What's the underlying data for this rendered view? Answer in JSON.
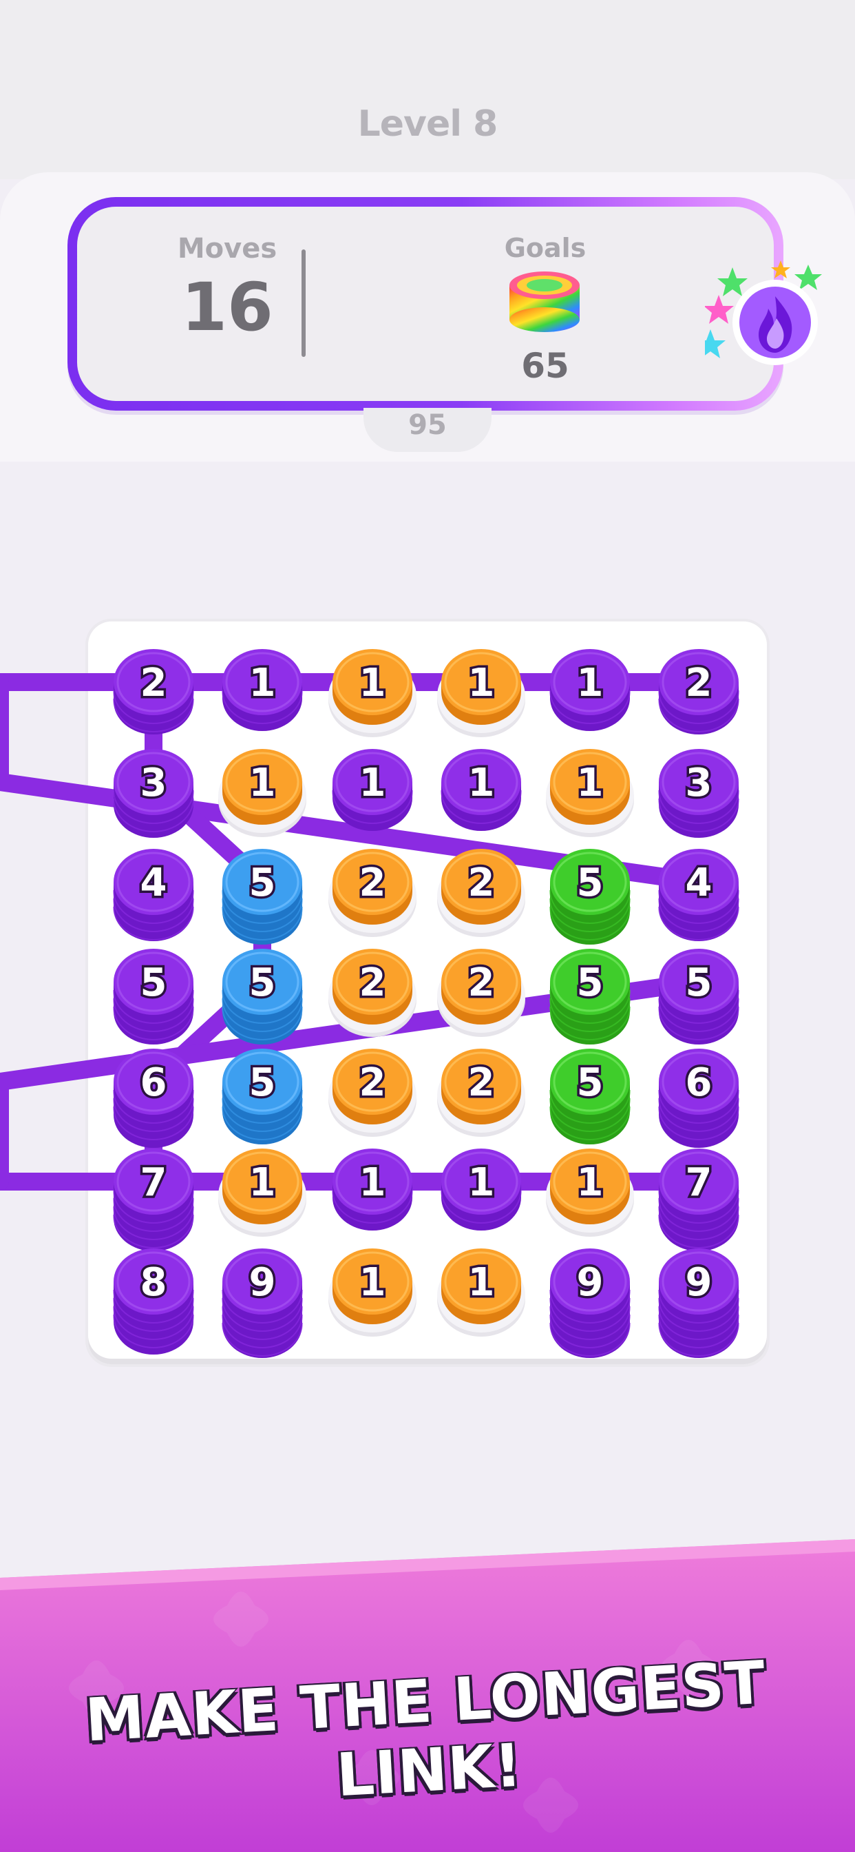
{
  "level_title": "Level 8",
  "hud": {
    "moves_label": "Moves",
    "moves_value": "16",
    "goals_label": "Goals",
    "goal_icon": "rainbow-chip-stack-icon",
    "goals_value": "65",
    "score_value": "95",
    "booster_icon": "purple-flame-icon"
  },
  "colors": {
    "purple": "#8b2be2",
    "orange": "#fba12a",
    "blue": "#3a9ce8",
    "green": "#3fcb2a",
    "accent": "#8a3df5",
    "banner_pink": "#f27ad6",
    "banner_magenta": "#c23fd8"
  },
  "board": {
    "rows": [
      [
        {
          "c": "purple",
          "n": "2",
          "h": 2
        },
        {
          "c": "purple",
          "n": "1",
          "h": 1
        },
        {
          "c": "orange",
          "n": "1",
          "h": 0
        },
        {
          "c": "orange",
          "n": "1",
          "h": 0
        },
        {
          "c": "purple",
          "n": "1",
          "h": 1
        },
        {
          "c": "purple",
          "n": "2",
          "h": 2
        }
      ],
      [
        {
          "c": "purple",
          "n": "3",
          "h": 3
        },
        {
          "c": "orange",
          "n": "1",
          "h": 0
        },
        {
          "c": "purple",
          "n": "1",
          "h": 1
        },
        {
          "c": "purple",
          "n": "1",
          "h": 1
        },
        {
          "c": "orange",
          "n": "1",
          "h": 0
        },
        {
          "c": "purple",
          "n": "3",
          "h": 3
        }
      ],
      [
        {
          "c": "purple",
          "n": "4",
          "h": 4
        },
        {
          "c": "blue",
          "n": "5",
          "h": 5
        },
        {
          "c": "orange",
          "n": "2",
          "h": 0
        },
        {
          "c": "orange",
          "n": "2",
          "h": 0
        },
        {
          "c": "green",
          "n": "5",
          "h": 5
        },
        {
          "c": "purple",
          "n": "4",
          "h": 4
        }
      ],
      [
        {
          "c": "purple",
          "n": "5",
          "h": 5
        },
        {
          "c": "blue",
          "n": "5",
          "h": 5
        },
        {
          "c": "orange",
          "n": "2",
          "h": 0
        },
        {
          "c": "orange",
          "n": "2",
          "h": 0
        },
        {
          "c": "green",
          "n": "5",
          "h": 5
        },
        {
          "c": "purple",
          "n": "5",
          "h": 5
        }
      ],
      [
        {
          "c": "purple",
          "n": "6",
          "h": 6
        },
        {
          "c": "blue",
          "n": "5",
          "h": 5
        },
        {
          "c": "orange",
          "n": "2",
          "h": 0
        },
        {
          "c": "orange",
          "n": "2",
          "h": 0
        },
        {
          "c": "green",
          "n": "5",
          "h": 5
        },
        {
          "c": "purple",
          "n": "6",
          "h": 6
        }
      ],
      [
        {
          "c": "purple",
          "n": "7",
          "h": 7
        },
        {
          "c": "orange",
          "n": "1",
          "h": 0
        },
        {
          "c": "purple",
          "n": "1",
          "h": 1
        },
        {
          "c": "purple",
          "n": "1",
          "h": 1
        },
        {
          "c": "orange",
          "n": "1",
          "h": 0
        },
        {
          "c": "purple",
          "n": "7",
          "h": 7
        }
      ],
      [
        {
          "c": "purple",
          "n": "8",
          "h": 8
        },
        {
          "c": "purple",
          "n": "9",
          "h": 9
        },
        {
          "c": "orange",
          "n": "1",
          "h": 0
        },
        {
          "c": "orange",
          "n": "1",
          "h": 0
        },
        {
          "c": "purple",
          "n": "9",
          "h": 9
        },
        {
          "c": "purple",
          "n": "9",
          "h": 9
        }
      ]
    ],
    "links": [
      [
        [
          0,
          1
        ],
        [
          0,
          0
        ]
      ],
      [
        [
          0,
          0
        ],
        [
          1,
          0
        ]
      ],
      [
        [
          1,
          0
        ],
        [
          2,
          0
        ]
      ],
      [
        [
          2,
          0
        ],
        [
          3,
          0
        ]
      ],
      [
        [
          3,
          0
        ],
        [
          4,
          0
        ]
      ],
      [
        [
          4,
          0
        ],
        [
          5,
          0
        ]
      ],
      [
        [
          5,
          0
        ],
        [
          6,
          0
        ]
      ],
      [
        [
          6,
          0
        ],
        [
          6,
          1
        ]
      ],
      [
        [
          6,
          1
        ],
        [
          5,
          2
        ]
      ],
      [
        [
          0,
          1
        ],
        [
          1,
          2
        ]
      ],
      [
        [
          1,
          2
        ],
        [
          1,
          3
        ]
      ],
      [
        [
          1,
          3
        ],
        [
          0,
          4
        ]
      ],
      [
        [
          0,
          4
        ],
        [
          0,
          5
        ]
      ],
      [
        [
          0,
          5
        ],
        [
          1,
          5
        ]
      ],
      [
        [
          1,
          5
        ],
        [
          2,
          5
        ]
      ],
      [
        [
          2,
          5
        ],
        [
          3,
          5
        ]
      ],
      [
        [
          3,
          5
        ],
        [
          4,
          5
        ]
      ],
      [
        [
          4,
          5
        ],
        [
          5,
          5
        ]
      ],
      [
        [
          5,
          5
        ],
        [
          6,
          5
        ]
      ],
      [
        [
          6,
          5
        ],
        [
          6,
          4
        ]
      ],
      [
        [
          6,
          4
        ],
        [
          5,
          3
        ]
      ]
    ]
  },
  "banner": {
    "text": "MAKE THE LONGEST LINK!"
  }
}
